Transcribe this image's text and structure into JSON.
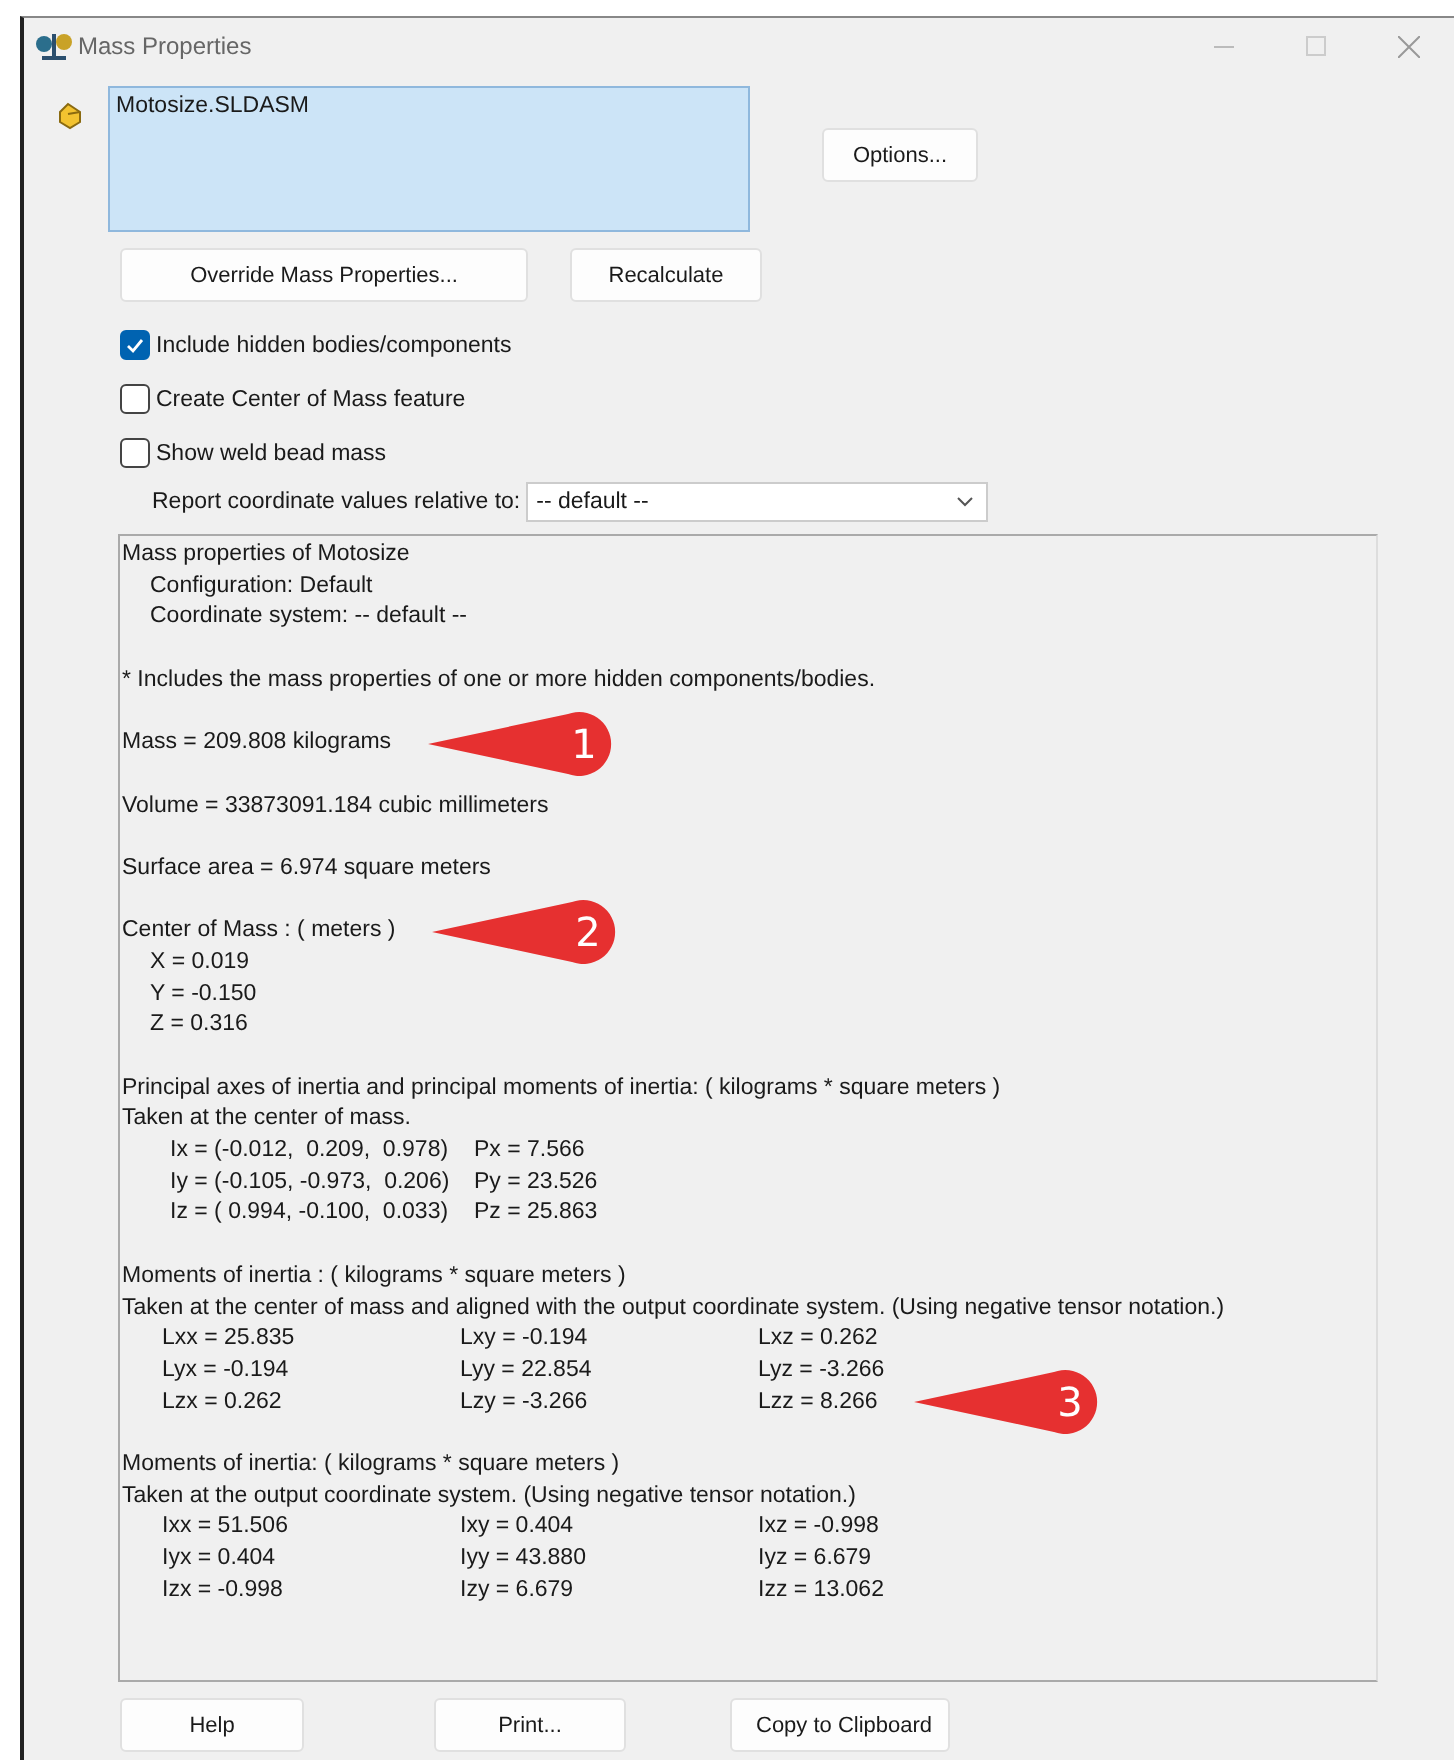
{
  "window": {
    "title": "Mass Properties"
  },
  "selection_box": {
    "items": [
      "Motosize.SLDASM"
    ]
  },
  "buttons_top": {
    "options": "Options...",
    "override": "Override Mass Properties...",
    "recalculate": "Recalculate"
  },
  "checkboxes": [
    {
      "label": "Include hidden bodies/components",
      "checked": true
    },
    {
      "label": "Create Center of Mass feature",
      "checked": false
    },
    {
      "label": "Show weld bead mass",
      "checked": false
    }
  ],
  "coordinate": {
    "label": "Report coordinate values relative to:",
    "value": "-- default --"
  },
  "report": [
    {
      "kind": "line",
      "text": "Mass properties of Motosize"
    },
    {
      "kind": "indented",
      "text": "Configuration: Default"
    },
    {
      "kind": "indented",
      "text": "Coordinate system: -- default --"
    },
    {
      "kind": "gap"
    },
    {
      "kind": "line",
      "text": "* Includes the mass properties of one or more hidden components/bodies."
    },
    {
      "kind": "gap"
    },
    {
      "kind": "line",
      "text": "Mass = 209.808 kilograms",
      "callout": "1"
    },
    {
      "kind": "gap"
    },
    {
      "kind": "line",
      "text": "Volume = 33873091.184 cubic millimeters"
    },
    {
      "kind": "gap"
    },
    {
      "kind": "line",
      "text": "Surface area = 6.974 square meters"
    },
    {
      "kind": "gap"
    },
    {
      "kind": "line",
      "text": "Center of Mass : ( meters )",
      "callout": "2"
    },
    {
      "kind": "indented",
      "text": "X = 0.019"
    },
    {
      "kind": "indented",
      "text": "Y = -0.150"
    },
    {
      "kind": "indented",
      "text": "Z = 0.316"
    },
    {
      "kind": "gap"
    },
    {
      "kind": "line",
      "text": "Principal axes of inertia and principal moments of inertia: ( kilograms * square meters )"
    },
    {
      "kind": "line",
      "text": "Taken at the center of mass."
    },
    {
      "kind": "axes",
      "cells": [
        "Ix = (-0.012,  0.209,  0.978)",
        "Px = 7.566"
      ]
    },
    {
      "kind": "axes",
      "cells": [
        "Iy = (-0.105, -0.973,  0.206)",
        "Py = 23.526"
      ]
    },
    {
      "kind": "axes",
      "cells": [
        "Iz = ( 0.994, -0.100,  0.033)",
        "Pz = 25.863"
      ]
    },
    {
      "kind": "gap"
    },
    {
      "kind": "line",
      "text": "Moments of inertia : ( kilograms * square meters )"
    },
    {
      "kind": "line",
      "text": "Taken at the center of mass and aligned with the output coordinate system. (Using negative tensor notation.)"
    },
    {
      "kind": "matrix",
      "cells": [
        "Lxx = 25.835",
        "Lxy = -0.194",
        "Lxz = 0.262"
      ]
    },
    {
      "kind": "matrix",
      "cells": [
        "Lyx = -0.194",
        "Lyy = 22.854",
        "Lyz = -3.266"
      ]
    },
    {
      "kind": "matrix",
      "cells": [
        "Lzx = 0.262",
        "Lzy = -3.266",
        "Lzz = 8.266"
      ],
      "callout": "3"
    },
    {
      "kind": "gap"
    },
    {
      "kind": "line",
      "text": "Moments of inertia: ( kilograms * square meters )"
    },
    {
      "kind": "line",
      "text": "Taken at the output coordinate system. (Using negative tensor notation.)"
    },
    {
      "kind": "matrix",
      "cells": [
        "Ixx = 51.506",
        "Ixy = 0.404",
        "Ixz = -0.998"
      ]
    },
    {
      "kind": "matrix",
      "cells": [
        "Iyx = 0.404",
        "Iyy = 43.880",
        "Iyz = 6.679"
      ]
    },
    {
      "kind": "matrix",
      "cells": [
        "Izx = -0.998",
        "Izy = 6.679",
        "Izz = 13.062"
      ]
    }
  ],
  "buttons_bottom": [
    "Help",
    "Print...",
    "Copy to Clipboard"
  ]
}
